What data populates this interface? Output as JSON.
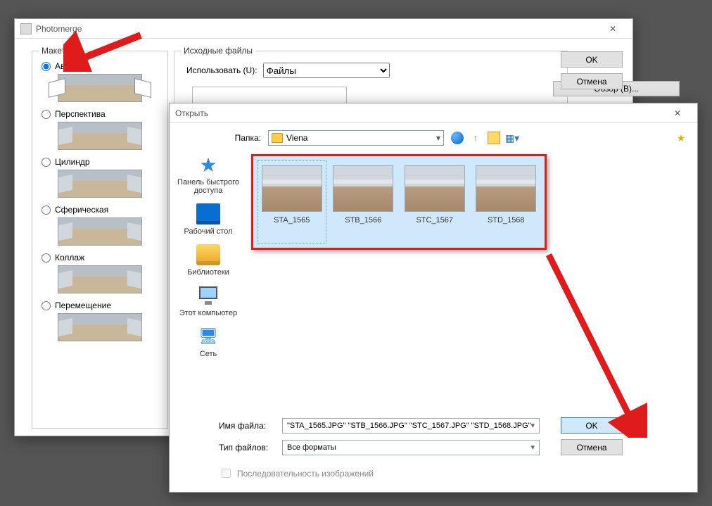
{
  "pm": {
    "title": "Photomerge",
    "layout_legend": "Макет",
    "layouts": [
      "Авто",
      "Перспектива",
      "Цилиндр",
      "Сферическая",
      "Коллаж",
      "Перемещение"
    ],
    "src_legend": "Исходные файлы",
    "use_label": "Использовать (U):",
    "use_value": "Файлы",
    "browse": "Обзор (B)...",
    "ok": "OK",
    "cancel": "Отмена"
  },
  "open": {
    "title": "Открыть",
    "folder_label": "Папка:",
    "folder_value": "Viena",
    "nav": {
      "quick": "Панель быстрого доступа",
      "desk": "Рабочий стол",
      "lib": "Библиотеки",
      "pc": "Этот компьютер",
      "net": "Сеть"
    },
    "files": [
      "STA_1565",
      "STB_1566",
      "STC_1567",
      "STD_1568"
    ],
    "filename_label": "Имя файла:",
    "filename_value": "\"STA_1565.JPG\" \"STB_1566.JPG\" \"STC_1567.JPG\" \"STD_1568.JPG\"",
    "filetype_label": "Тип файлов:",
    "filetype_value": "Все форматы",
    "seq": "Последовательность изображений",
    "ok": "OK",
    "cancel": "Отмена"
  }
}
